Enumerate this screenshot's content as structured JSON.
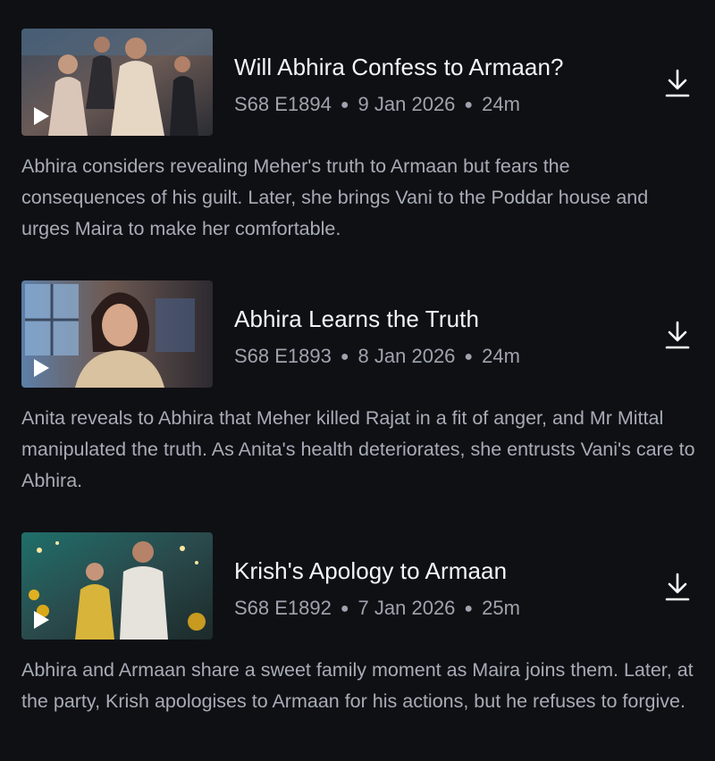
{
  "episodes": [
    {
      "title": "Will Abhira Confess to Armaan?",
      "season_episode": "S68 E1894",
      "date": "9 Jan 2026",
      "duration": "24m",
      "description": "Abhira considers revealing Meher's truth to Armaan but fears the consequences of his guilt. Later, she brings Vani to the Poddar house and urges Maira to make her comfortable."
    },
    {
      "title": "Abhira Learns the Truth",
      "season_episode": "S68 E1893",
      "date": "8 Jan 2026",
      "duration": "24m",
      "description": "Anita reveals to Abhira that Meher killed Rajat in a fit of anger, and Mr Mittal manipulated the truth. As Anita's health deteriorates, she entrusts Vani's care to Abhira."
    },
    {
      "title": "Krish's Apology to Armaan",
      "season_episode": "S68 E1892",
      "date": "7 Jan 2026",
      "duration": "25m",
      "description": "Abhira and Armaan share a sweet family moment as Maira joins them. Later, at the party, Krish apologises to Armaan for his actions, but he refuses to forgive."
    }
  ],
  "icons": {
    "play": "play-icon",
    "download": "download-icon"
  },
  "colors": {
    "background": "#0f1014",
    "title": "#f4f4f6",
    "meta": "#9ea3ad",
    "description": "#a7acb6"
  }
}
